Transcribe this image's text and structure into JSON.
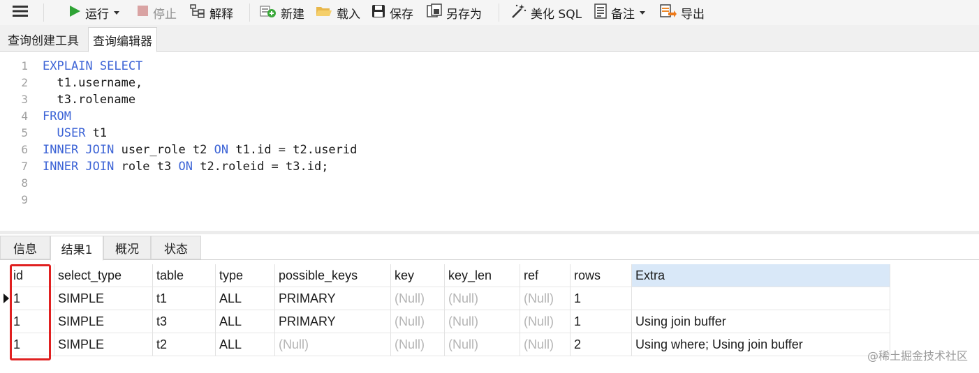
{
  "toolbar": {
    "menu_icon": "hamburger-menu-icon",
    "run": "运行",
    "stop": "停止",
    "explain": "解释",
    "new": "新建",
    "load": "载入",
    "save": "保存",
    "save_as": "另存为",
    "beautify": "美化 SQL",
    "notes": "备注",
    "export": "导出"
  },
  "query_tabs": [
    "查询创建工具",
    "查询编辑器"
  ],
  "active_query_tab": 1,
  "editor": {
    "line_numbers": [
      "1",
      "2",
      "3",
      "4",
      "5",
      "6",
      "7",
      "8",
      "9"
    ],
    "lines": [
      [
        {
          "t": "EXPLAIN SELECT",
          "kw": true
        }
      ],
      [
        {
          "t": "  t1.username,",
          "kw": false
        }
      ],
      [
        {
          "t": "  t3.rolename",
          "kw": false
        }
      ],
      [
        {
          "t": "FROM",
          "kw": true
        }
      ],
      [
        {
          "t": "  ",
          "kw": false
        },
        {
          "t": "USER",
          "kw": true
        },
        {
          "t": " t1",
          "kw": false
        }
      ],
      [
        {
          "t": "INNER JOIN",
          "kw": true
        },
        {
          "t": " user_role t2 ",
          "kw": false
        },
        {
          "t": "ON",
          "kw": true
        },
        {
          "t": " t1.id = t2.userid",
          "kw": false
        }
      ],
      [
        {
          "t": "INNER JOIN",
          "kw": true
        },
        {
          "t": " role t3 ",
          "kw": false
        },
        {
          "t": "ON",
          "kw": true
        },
        {
          "t": " t2.roleid = t3.id;",
          "kw": false
        }
      ],
      [],
      []
    ],
    "keyword_color": "#3d64d6"
  },
  "result_tabs": [
    "信息",
    "结果1",
    "概况",
    "状态"
  ],
  "active_result_tab": 1,
  "grid": {
    "columns": [
      "id",
      "select_type",
      "table",
      "type",
      "possible_keys",
      "key",
      "key_len",
      "ref",
      "rows",
      "Extra"
    ],
    "rows": [
      [
        "1",
        "SIMPLE",
        "t1",
        "ALL",
        "PRIMARY",
        "(Null)",
        "(Null)",
        "(Null)",
        "1",
        ""
      ],
      [
        "1",
        "SIMPLE",
        "t3",
        "ALL",
        "PRIMARY",
        "(Null)",
        "(Null)",
        "(Null)",
        "1",
        "Using join buffer"
      ],
      [
        "1",
        "SIMPLE",
        "t2",
        "ALL",
        "(Null)",
        "(Null)",
        "(Null)",
        "(Null)",
        "2",
        "Using where; Using join buffer"
      ]
    ],
    "selected_row": 0,
    "highlight_color": "#e02020",
    "header_highlight_color": "#d9e8f8"
  },
  "watermark": "@稀土掘金技术社区"
}
